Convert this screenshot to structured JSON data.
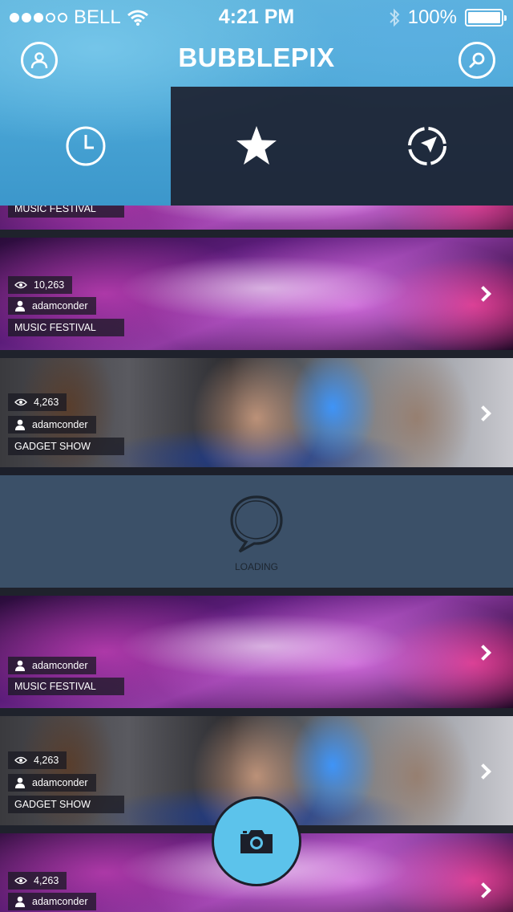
{
  "status_bar": {
    "carrier": "BELL",
    "time": "4:21 PM",
    "battery": "100%",
    "signal_bars_filled": 3,
    "signal_bars_total": 5
  },
  "header": {
    "title": "BUBBLEPIX",
    "profile_icon": "user-icon",
    "search_icon": "search-icon"
  },
  "tabs": [
    {
      "icon": "clock-icon",
      "selected": true
    },
    {
      "icon": "star-icon",
      "selected": false
    },
    {
      "icon": "compass-icon",
      "selected": false
    }
  ],
  "feed": {
    "partial_top_category": "MUSIC FESTIVAL",
    "items": [
      {
        "views": "10,263",
        "user": "adamconder",
        "category": "MUSIC FESTIVAL",
        "scene": "music"
      },
      {
        "views": "4,263",
        "user": "adamconder",
        "category": "GADGET SHOW",
        "scene": "gadget"
      },
      {
        "views": "",
        "user": "adamconder",
        "category": "MUSIC FESTIVAL",
        "scene": "music"
      },
      {
        "views": "4,263",
        "user": "adamconder",
        "category": "GADGET SHOW",
        "scene": "gadget"
      },
      {
        "views": "4,263",
        "user": "adamconder",
        "category": "",
        "scene": "music"
      }
    ],
    "loading_text": "LOADING"
  },
  "camera_button": {
    "icon": "camera-icon"
  },
  "colors": {
    "accent": "#5cc3eb",
    "header_blue": "#4aa6d6",
    "tab_dark": "#1c1e2c",
    "loading_bg": "#3b5068"
  }
}
